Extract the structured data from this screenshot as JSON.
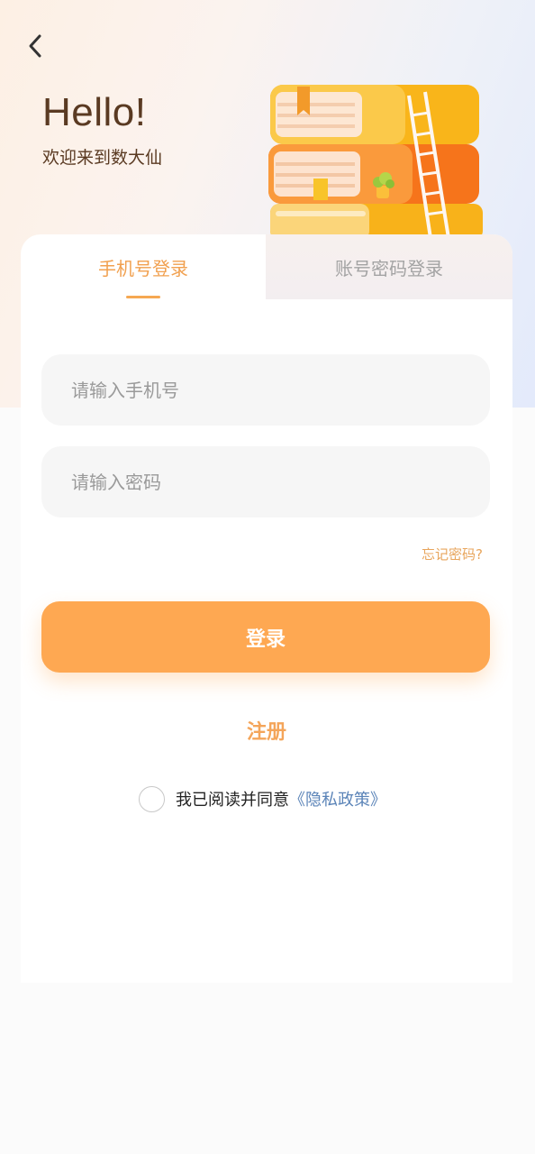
{
  "header": {
    "greeting": "Hello!",
    "subtitle": "欢迎来到数大仙",
    "back_icon": "chevron-left-icon"
  },
  "tabs": [
    {
      "label": "手机号登录",
      "active": true
    },
    {
      "label": "账号密码登录",
      "active": false
    }
  ],
  "form": {
    "phone_placeholder": "请输入手机号",
    "password_placeholder": "请输入密码",
    "forgot_label": "忘记密码?",
    "login_label": "登录",
    "register_label": "注册"
  },
  "agreement": {
    "text": "我已阅读并同意",
    "link": "《隐私政策》",
    "checked": false
  },
  "colors": {
    "accent": "#fea852",
    "accent_text": "#f1a04f",
    "link": "#5b84b8",
    "heading": "#5a3a22"
  },
  "illustration": "stacked-books-with-ladder"
}
